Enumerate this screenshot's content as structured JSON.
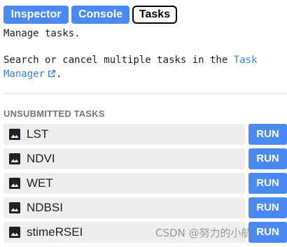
{
  "tabs": {
    "inspector": "Inspector",
    "console": "Console",
    "tasks": "Tasks",
    "active": "Tasks"
  },
  "intro": {
    "manage": "Manage tasks.",
    "search_prefix": "Search or cancel multiple tasks in the",
    "link_part1": "Task",
    "link_part2": "Manager",
    "suffix": "."
  },
  "unsubmitted": {
    "title": "UNSUBMITTED TASKS",
    "run_label": "RUN",
    "icon": "image-icon",
    "tasks": [
      {
        "name": "LST"
      },
      {
        "name": "NDVI"
      },
      {
        "name": "WET"
      },
      {
        "name": "NDBSI"
      },
      {
        "name": "stimeRSEI"
      }
    ]
  },
  "watermark": "CSDN @努力的小航",
  "colors": {
    "accent": "#4a8af4",
    "link": "#3e7fe8",
    "row_bg": "#eeeeee",
    "section_title": "#757575"
  }
}
